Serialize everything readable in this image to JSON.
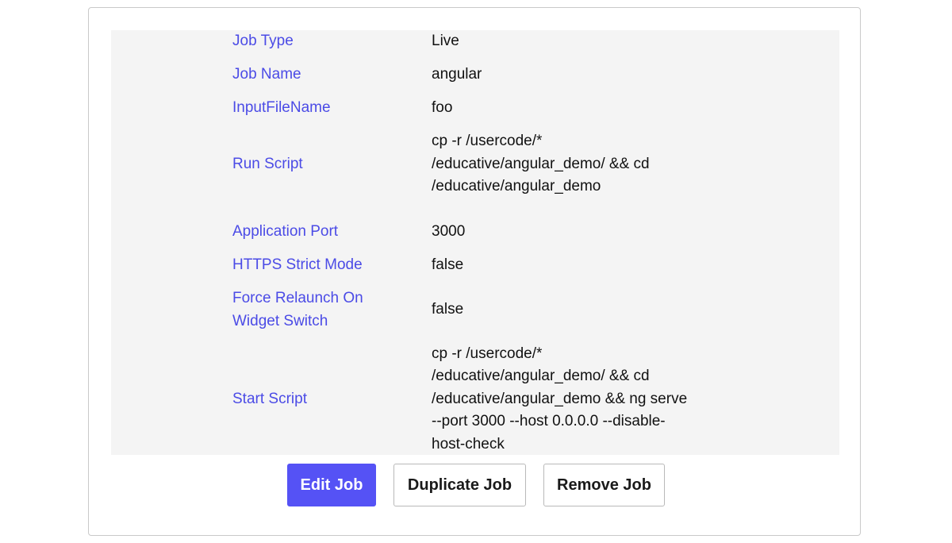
{
  "job_details": {
    "rows": [
      {
        "label": "Job Type",
        "value": "Live"
      },
      {
        "label": "Job Name",
        "value": "angular"
      },
      {
        "label": "InputFileName",
        "value": "foo"
      },
      {
        "label": "Run Script",
        "value": "cp -r /usercode/* /educative/angular_demo/ && cd /educative/angular_demo"
      },
      {
        "label": "Application Port",
        "value": "3000"
      },
      {
        "label": "HTTPS Strict Mode",
        "value": "false"
      },
      {
        "label": "Force Relaunch On Widget Switch",
        "value": "false"
      },
      {
        "label": "Start Script",
        "value": "cp -r /usercode/* /educative/angular_demo/ && cd /educative/angular_demo && ng serve --port 3000 --host 0.0.0.0 --disable-host-check"
      }
    ]
  },
  "actions": {
    "edit_label": "Edit Job",
    "duplicate_label": "Duplicate Job",
    "remove_label": "Remove Job"
  },
  "colors": {
    "label_text": "#4b4be6",
    "primary_button": "#5552f5",
    "details_background": "#f4f4f4"
  }
}
